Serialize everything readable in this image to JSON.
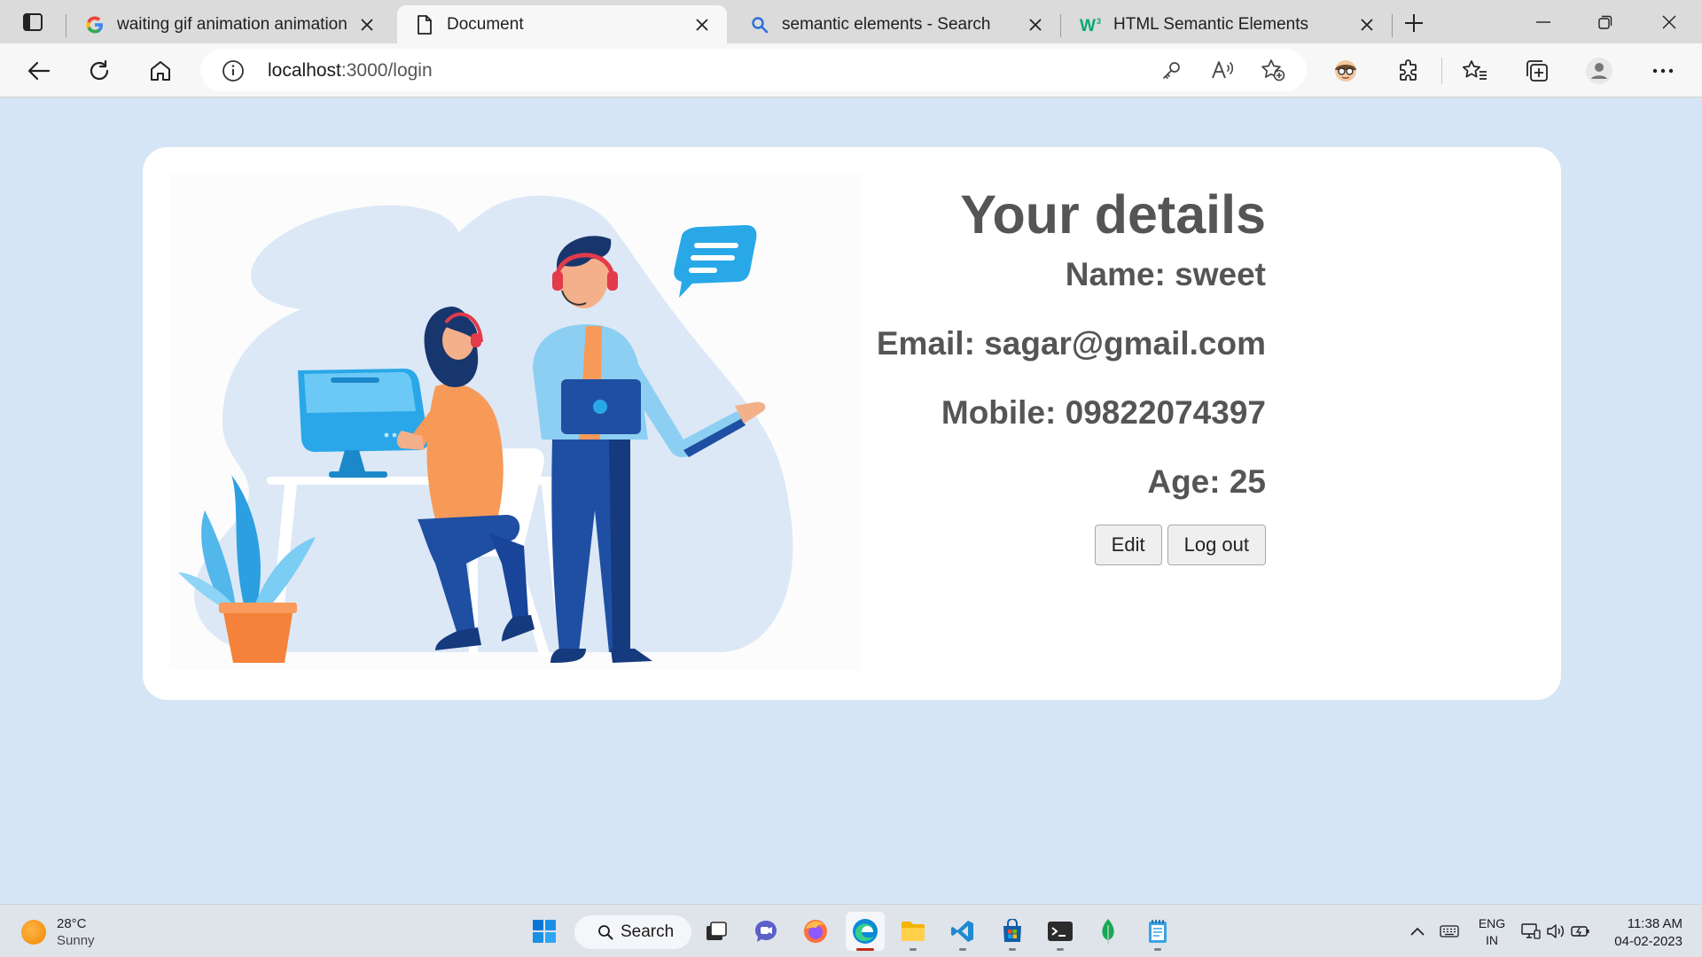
{
  "browser": {
    "tabs": [
      {
        "title": "waiting gif animation animation",
        "favicon": "google-g-icon",
        "active": false
      },
      {
        "title": "Document",
        "favicon": "document-icon",
        "active": true
      },
      {
        "title": "semantic elements - Search",
        "favicon": "bing-search-icon",
        "active": false
      },
      {
        "title": "HTML Semantic Elements",
        "favicon": "w3schools-icon",
        "active": false
      }
    ],
    "address": {
      "host": "localhost",
      "path": ":3000/login"
    }
  },
  "page": {
    "heading": "Your details",
    "name_line": "Name: sweet",
    "email_line": "Email: sagar@gmail.com",
    "mobile_line": "Mobile: 09822074397",
    "age_line": "Age: 25",
    "edit_label": "Edit",
    "logout_label": "Log out"
  },
  "taskbar": {
    "weather_temp": "28°C",
    "weather_cond": "Sunny",
    "search_label": "Search",
    "lang_1": "ENG",
    "lang_2": "IN",
    "time": "11:38 AM",
    "date": "04-02-2023"
  },
  "colors": {
    "page_bg": "#d6e5f5",
    "card_bg": "#ffffff",
    "text": "#555555",
    "accent_blue": "#1e9be0",
    "navy": "#1f4fa3",
    "orange": "#f79a58"
  }
}
